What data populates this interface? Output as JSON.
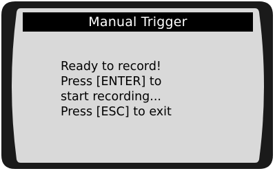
{
  "screen": {
    "title": "Manual Trigger",
    "message_lines": [
      "Ready to record!",
      "Press [ENTER] to",
      "start recording...",
      "Press [ESC] to exit"
    ]
  },
  "colors": {
    "bezel": "#1a1a1a",
    "screen_bg": "#d9d9d9",
    "title_bg": "#000000",
    "title_text": "#ffffff",
    "body_text": "#000000"
  }
}
